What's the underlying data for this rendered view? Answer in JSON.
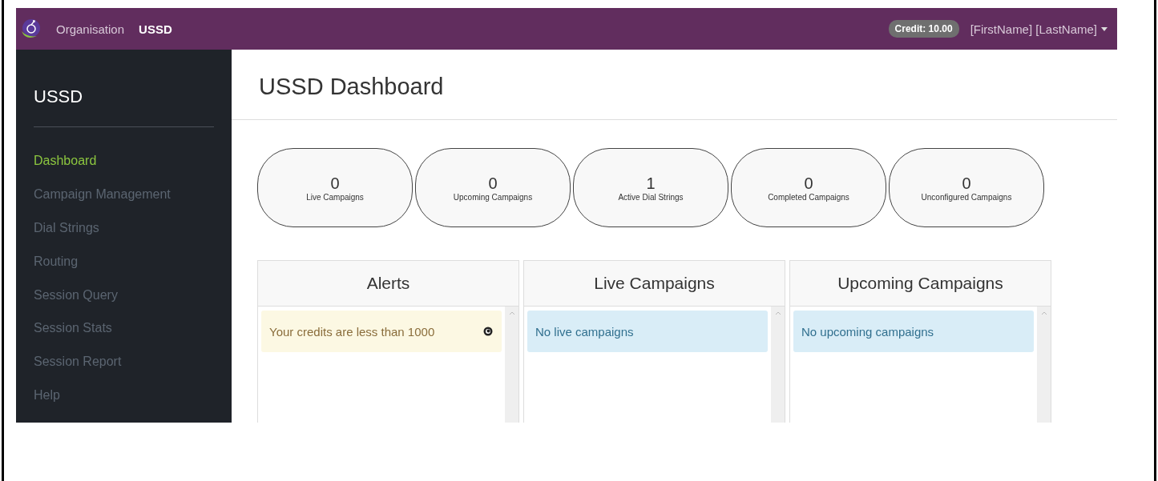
{
  "navbar": {
    "links": [
      {
        "label": "Organisation",
        "selected": false
      },
      {
        "label": "USSD",
        "selected": true
      }
    ],
    "credit": "Credit: 10.00",
    "user": "[FirstName] [LastName]"
  },
  "sidebar": {
    "title": "USSD",
    "items": [
      {
        "label": "Dashboard",
        "selected": true
      },
      {
        "label": "Campaign Management",
        "selected": false
      },
      {
        "label": "Dial Strings",
        "selected": false
      },
      {
        "label": "Routing",
        "selected": false
      },
      {
        "label": "Session Query",
        "selected": false
      },
      {
        "label": "Session Stats",
        "selected": false
      },
      {
        "label": "Session Report",
        "selected": false
      },
      {
        "label": "Help",
        "selected": false
      }
    ]
  },
  "page_title": "USSD Dashboard",
  "stats": [
    {
      "value": "0",
      "label": "Live Campaigns"
    },
    {
      "value": "0",
      "label": "Upcoming Campaigns"
    },
    {
      "value": "1",
      "label": "Active Dial Strings"
    },
    {
      "value": "0",
      "label": "Completed Campaigns"
    },
    {
      "value": "0",
      "label": "Unconfigured Campaigns"
    }
  ],
  "panels": [
    {
      "title": "Alerts",
      "message": {
        "kind": "warning",
        "text": "Your credits are less than 1000"
      }
    },
    {
      "title": "Live Campaigns",
      "message": {
        "kind": "info",
        "text": "No live campaigns"
      }
    },
    {
      "title": "Upcoming Campaigns",
      "message": {
        "kind": "info",
        "text": "No upcoming campaigns"
      }
    }
  ]
}
